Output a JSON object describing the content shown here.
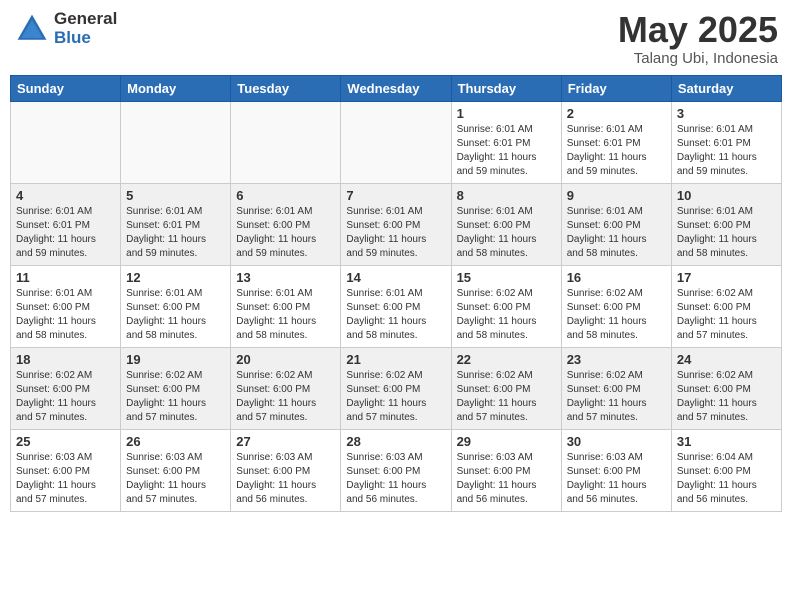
{
  "logo": {
    "general": "General",
    "blue": "Blue"
  },
  "title": {
    "month_year": "May 2025",
    "location": "Talang Ubi, Indonesia"
  },
  "weekdays": [
    "Sunday",
    "Monday",
    "Tuesday",
    "Wednesday",
    "Thursday",
    "Friday",
    "Saturday"
  ],
  "weeks": [
    [
      {
        "day": "",
        "empty": true
      },
      {
        "day": "",
        "empty": true
      },
      {
        "day": "",
        "empty": true
      },
      {
        "day": "",
        "empty": true
      },
      {
        "day": "1",
        "sunrise": "6:01 AM",
        "sunset": "6:01 PM",
        "daylight": "11 hours and 59 minutes."
      },
      {
        "day": "2",
        "sunrise": "6:01 AM",
        "sunset": "6:01 PM",
        "daylight": "11 hours and 59 minutes."
      },
      {
        "day": "3",
        "sunrise": "6:01 AM",
        "sunset": "6:01 PM",
        "daylight": "11 hours and 59 minutes."
      }
    ],
    [
      {
        "day": "4",
        "sunrise": "6:01 AM",
        "sunset": "6:01 PM",
        "daylight": "11 hours and 59 minutes."
      },
      {
        "day": "5",
        "sunrise": "6:01 AM",
        "sunset": "6:01 PM",
        "daylight": "11 hours and 59 minutes."
      },
      {
        "day": "6",
        "sunrise": "6:01 AM",
        "sunset": "6:00 PM",
        "daylight": "11 hours and 59 minutes."
      },
      {
        "day": "7",
        "sunrise": "6:01 AM",
        "sunset": "6:00 PM",
        "daylight": "11 hours and 59 minutes."
      },
      {
        "day": "8",
        "sunrise": "6:01 AM",
        "sunset": "6:00 PM",
        "daylight": "11 hours and 58 minutes."
      },
      {
        "day": "9",
        "sunrise": "6:01 AM",
        "sunset": "6:00 PM",
        "daylight": "11 hours and 58 minutes."
      },
      {
        "day": "10",
        "sunrise": "6:01 AM",
        "sunset": "6:00 PM",
        "daylight": "11 hours and 58 minutes."
      }
    ],
    [
      {
        "day": "11",
        "sunrise": "6:01 AM",
        "sunset": "6:00 PM",
        "daylight": "11 hours and 58 minutes."
      },
      {
        "day": "12",
        "sunrise": "6:01 AM",
        "sunset": "6:00 PM",
        "daylight": "11 hours and 58 minutes."
      },
      {
        "day": "13",
        "sunrise": "6:01 AM",
        "sunset": "6:00 PM",
        "daylight": "11 hours and 58 minutes."
      },
      {
        "day": "14",
        "sunrise": "6:01 AM",
        "sunset": "6:00 PM",
        "daylight": "11 hours and 58 minutes."
      },
      {
        "day": "15",
        "sunrise": "6:02 AM",
        "sunset": "6:00 PM",
        "daylight": "11 hours and 58 minutes."
      },
      {
        "day": "16",
        "sunrise": "6:02 AM",
        "sunset": "6:00 PM",
        "daylight": "11 hours and 58 minutes."
      },
      {
        "day": "17",
        "sunrise": "6:02 AM",
        "sunset": "6:00 PM",
        "daylight": "11 hours and 57 minutes."
      }
    ],
    [
      {
        "day": "18",
        "sunrise": "6:02 AM",
        "sunset": "6:00 PM",
        "daylight": "11 hours and 57 minutes."
      },
      {
        "day": "19",
        "sunrise": "6:02 AM",
        "sunset": "6:00 PM",
        "daylight": "11 hours and 57 minutes."
      },
      {
        "day": "20",
        "sunrise": "6:02 AM",
        "sunset": "6:00 PM",
        "daylight": "11 hours and 57 minutes."
      },
      {
        "day": "21",
        "sunrise": "6:02 AM",
        "sunset": "6:00 PM",
        "daylight": "11 hours and 57 minutes."
      },
      {
        "day": "22",
        "sunrise": "6:02 AM",
        "sunset": "6:00 PM",
        "daylight": "11 hours and 57 minutes."
      },
      {
        "day": "23",
        "sunrise": "6:02 AM",
        "sunset": "6:00 PM",
        "daylight": "11 hours and 57 minutes."
      },
      {
        "day": "24",
        "sunrise": "6:02 AM",
        "sunset": "6:00 PM",
        "daylight": "11 hours and 57 minutes."
      }
    ],
    [
      {
        "day": "25",
        "sunrise": "6:03 AM",
        "sunset": "6:00 PM",
        "daylight": "11 hours and 57 minutes."
      },
      {
        "day": "26",
        "sunrise": "6:03 AM",
        "sunset": "6:00 PM",
        "daylight": "11 hours and 57 minutes."
      },
      {
        "day": "27",
        "sunrise": "6:03 AM",
        "sunset": "6:00 PM",
        "daylight": "11 hours and 56 minutes."
      },
      {
        "day": "28",
        "sunrise": "6:03 AM",
        "sunset": "6:00 PM",
        "daylight": "11 hours and 56 minutes."
      },
      {
        "day": "29",
        "sunrise": "6:03 AM",
        "sunset": "6:00 PM",
        "daylight": "11 hours and 56 minutes."
      },
      {
        "day": "30",
        "sunrise": "6:03 AM",
        "sunset": "6:00 PM",
        "daylight": "11 hours and 56 minutes."
      },
      {
        "day": "31",
        "sunrise": "6:04 AM",
        "sunset": "6:00 PM",
        "daylight": "11 hours and 56 minutes."
      }
    ]
  ]
}
